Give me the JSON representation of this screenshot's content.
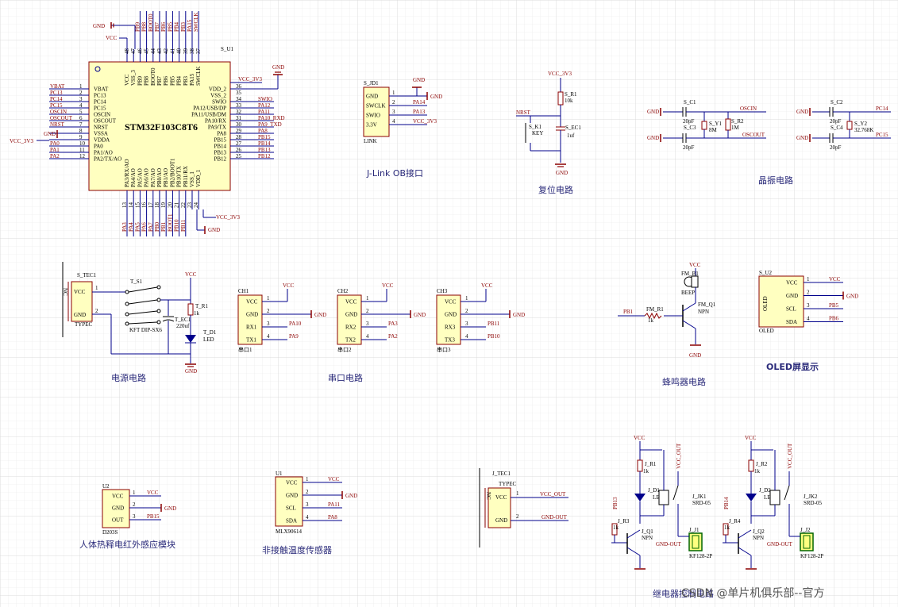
{
  "mcu": {
    "designator": "S_U1",
    "part": "STM32F103C8T6",
    "left_pins": [
      {
        "num": "1",
        "name": "VBAT",
        "net": "VBAT"
      },
      {
        "num": "2",
        "name": "PC13",
        "net": "PC13"
      },
      {
        "num": "3",
        "name": "PC14",
        "net": "PC14"
      },
      {
        "num": "4",
        "name": "PC15",
        "net": "PC15"
      },
      {
        "num": "5",
        "name": "OSCIN",
        "net": "OSCIN"
      },
      {
        "num": "6",
        "name": "OSCOUT",
        "net": "OSCOUT"
      },
      {
        "num": "7",
        "name": "NRST",
        "net": "NRST"
      },
      {
        "num": "8",
        "name": "VSSA",
        "net": "GND"
      },
      {
        "num": "9",
        "name": "VDDA",
        "net": "VCC_3V3"
      },
      {
        "num": "10",
        "name": "PA0",
        "net": "PA0"
      },
      {
        "num": "11",
        "name": "PA1/AO",
        "net": "PA1"
      },
      {
        "num": "12",
        "name": "PA2/TX/AO",
        "net": "PA2"
      }
    ],
    "right_pins": [
      {
        "num": "36",
        "name": "VDD_2",
        "net": ""
      },
      {
        "num": "35",
        "name": "VSS_2",
        "net": ""
      },
      {
        "num": "34",
        "name": "SWIO",
        "net": "SWIO"
      },
      {
        "num": "33",
        "name": "PA12/USB/DP",
        "net": "PA12"
      },
      {
        "num": "32",
        "name": "PA11/USB/DM",
        "net": "PA11"
      },
      {
        "num": "31",
        "name": "PA10/RX",
        "net": "PA10_RXD"
      },
      {
        "num": "30",
        "name": "PA9/TX",
        "net": "PA9_TXD"
      },
      {
        "num": "29",
        "name": "PA8",
        "net": "PA8"
      },
      {
        "num": "28",
        "name": "PB15",
        "net": "PB15"
      },
      {
        "num": "27",
        "name": "PB14",
        "net": "PB14"
      },
      {
        "num": "26",
        "name": "PB13",
        "net": "PB13"
      },
      {
        "num": "25",
        "name": "PB12",
        "net": "PB12"
      }
    ],
    "top_pins": [
      {
        "num": "48",
        "name": "VCC",
        "net": ""
      },
      {
        "num": "47",
        "name": "VSS_3",
        "net": ""
      },
      {
        "num": "46",
        "name": "PB9",
        "net": "PB9"
      },
      {
        "num": "45",
        "name": "PB8",
        "net": "PB8"
      },
      {
        "num": "44",
        "name": "BOOT0",
        "net": "BOOT0"
      },
      {
        "num": "43",
        "name": "PB7",
        "net": "PB7"
      },
      {
        "num": "42",
        "name": "PB6",
        "net": "PB6"
      },
      {
        "num": "41",
        "name": "PB5",
        "net": "PB5"
      },
      {
        "num": "40",
        "name": "PB4",
        "net": "PB4"
      },
      {
        "num": "39",
        "name": "PB3",
        "net": "PB3"
      },
      {
        "num": "38",
        "name": "PA15",
        "net": "PA15"
      },
      {
        "num": "37",
        "name": "SWCLK",
        "net": "SWCLK"
      }
    ],
    "bottom_pins": [
      {
        "num": "13",
        "name": "PA3/RX/AO",
        "net": "PA3"
      },
      {
        "num": "14",
        "name": "PA4/AO",
        "net": "PA4"
      },
      {
        "num": "15",
        "name": "PA5/AO",
        "net": "PA5"
      },
      {
        "num": "16",
        "name": "PA6/AO",
        "net": "PA6"
      },
      {
        "num": "17",
        "name": "PA7/AO",
        "net": "PA7"
      },
      {
        "num": "18",
        "name": "PB0/AO",
        "net": "PB0"
      },
      {
        "num": "19",
        "name": "PB1/AO",
        "net": "PB1"
      },
      {
        "num": "20",
        "name": "PB2/BOOT1",
        "net": "BOOT1"
      },
      {
        "num": "21",
        "name": "PB10/TX",
        "net": "PB10"
      },
      {
        "num": "22",
        "name": "PB11/RX",
        "net": "PB11"
      },
      {
        "num": "23",
        "name": "VSS_1",
        "net": ""
      },
      {
        "num": "24",
        "name": "VDD_1",
        "net": ""
      }
    ],
    "power_labels": {
      "gnd": "GND",
      "vcc": "VCC",
      "vcc3v3": "VCC_3V3"
    }
  },
  "jlink": {
    "designator": "S_JD1",
    "footer": "LINK",
    "pins": [
      {
        "num": "1",
        "name": "GND",
        "net": "GND"
      },
      {
        "num": "2",
        "name": "SWCLK",
        "net": "PA14"
      },
      {
        "num": "3",
        "name": "SWIO",
        "net": "PA13"
      },
      {
        "num": "4",
        "name": "3.3V",
        "net": "VCC_3V3"
      }
    ],
    "title": "J-Link OB接口"
  },
  "reset": {
    "vcc": "VCC_3V3",
    "r": "S_R1",
    "r_val": "10k",
    "net": "NRST",
    "key": "S_K1",
    "key_val": "KEY",
    "cap": "S_EC1",
    "cap_val": "1uf",
    "gnd": "GND",
    "title": "复位电路"
  },
  "crystal": {
    "c1": "S_C1",
    "c2": "S_C3",
    "y1": "S_Y1",
    "y1_val": "8M",
    "r2": "S_R2",
    "r2_val": "1M",
    "cval": "20pF",
    "oscin": "OSCIN",
    "oscout": "OSCOUT",
    "c3": "S_C2",
    "c4": "S_C4",
    "y2": "S_Y2",
    "y2_val": "32.768K",
    "pc14": "PC14",
    "pc15": "PC15",
    "gnd": "GND",
    "title": "晶振电路"
  },
  "power": {
    "tec": "S_TEC1",
    "tec_type": "TYPEC",
    "nc": "NC",
    "vcc_pin": "VCC",
    "gnd_pin": "GND",
    "sw": "T_S1",
    "sw_val": "KFT DIP-SX6",
    "cap": "T_EC1",
    "cap_val": "220uf",
    "r": "T_R1",
    "r_val": "1k",
    "led": "T_D1",
    "led_val": "LED",
    "vcc": "VCC",
    "gnd": "GND",
    "pin1": "1",
    "pin2": "2",
    "title": "电源电路"
  },
  "serial": {
    "ports": [
      {
        "des": "CH1",
        "foot": "串口1",
        "rx": "PA10",
        "tx": "PA9",
        "rxname": "RX1",
        "txname": "TX1"
      },
      {
        "des": "CH2",
        "foot": "串口2",
        "rx": "PA3",
        "tx": "PA2",
        "rxname": "RX2",
        "txname": "TX2"
      },
      {
        "des": "CH3",
        "foot": "串口3",
        "rx": "PB11",
        "tx": "PB10",
        "rxname": "RX3",
        "txname": "TX3"
      }
    ],
    "vcc": "VCC",
    "gnd": "GND",
    "gnd_name": "GND",
    "vcc_name": "VCC",
    "title": "串口电路"
  },
  "buzzer": {
    "des": "FM_B1",
    "val": "BEEP",
    "q": "FM_Q1",
    "q_val": "NPN",
    "r": "FM_R1",
    "r_val": "1k",
    "net": "PB1",
    "vcc": "VCC",
    "gnd": "GND",
    "title": "蜂鸣器电路"
  },
  "oled": {
    "des": "S_U2",
    "name": "OLED",
    "foot": "OLED",
    "pins": [
      {
        "num": "1",
        "name": "VCC",
        "net": "VCC"
      },
      {
        "num": "2",
        "name": "GND",
        "net": "GND"
      },
      {
        "num": "3",
        "name": "SCL",
        "net": "PB5"
      },
      {
        "num": "4",
        "name": "SDA",
        "net": "PB6"
      }
    ],
    "title": "OLED屏显示"
  },
  "pir": {
    "des": "U2",
    "foot": "D203S",
    "pins": [
      {
        "num": "1",
        "name": "VCC",
        "net": "VCC"
      },
      {
        "num": "2",
        "name": "GND",
        "net": "GND"
      },
      {
        "num": "3",
        "name": "OUT",
        "net": "PB15"
      }
    ],
    "title": "人体热释电红外感应模块"
  },
  "ir_temp": {
    "des": "U1",
    "foot": "MLX90614",
    "pins": [
      {
        "num": "1",
        "name": "VCC",
        "net": "VCC"
      },
      {
        "num": "2",
        "name": "GND",
        "net": "GND"
      },
      {
        "num": "3",
        "name": "SCL",
        "net": "PA11"
      },
      {
        "num": "4",
        "name": "SDA",
        "net": "PA8"
      }
    ],
    "title": "非接触温度传感器"
  },
  "typec_out": {
    "des": "J_TEC1",
    "type": "TYPEC",
    "nc": "NC",
    "vcc_pin": "VCC",
    "gnd_pin": "GND",
    "vcc_net": "VCC_OUT",
    "gnd_net": "GND-OUT",
    "pin1": "1",
    "pin2": "2"
  },
  "relay": {
    "channels": [
      {
        "r1": "J_R1",
        "r3": "J_R3",
        "q": "J_Q1",
        "d": "J_D1",
        "jk": "J_JK1",
        "j": "J_J1",
        "net": "PB13"
      },
      {
        "r1": "J_R2",
        "r3": "J_R4",
        "q": "J_Q2",
        "d": "J_D2",
        "jk": "J_JK2",
        "j": "J_J2",
        "net": "PB14"
      }
    ],
    "vcc": "VCC",
    "vcc_out": "VCC_OUT",
    "gnd_out": "GND-OUT",
    "rval": "1k",
    "npn": "NPN",
    "led": "LED",
    "relay": "SRD-05",
    "conn": "KF128-2P",
    "title": "继电器控制电路"
  },
  "watermark": "CSDN @单片机俱乐部--官方",
  "colors": {
    "wire": "#00008b",
    "body": "#ffffc0",
    "body_stroke": "#8b0000",
    "net": "#8b0000",
    "grid": "#e6e6e6",
    "title": "#2a2a7a"
  }
}
